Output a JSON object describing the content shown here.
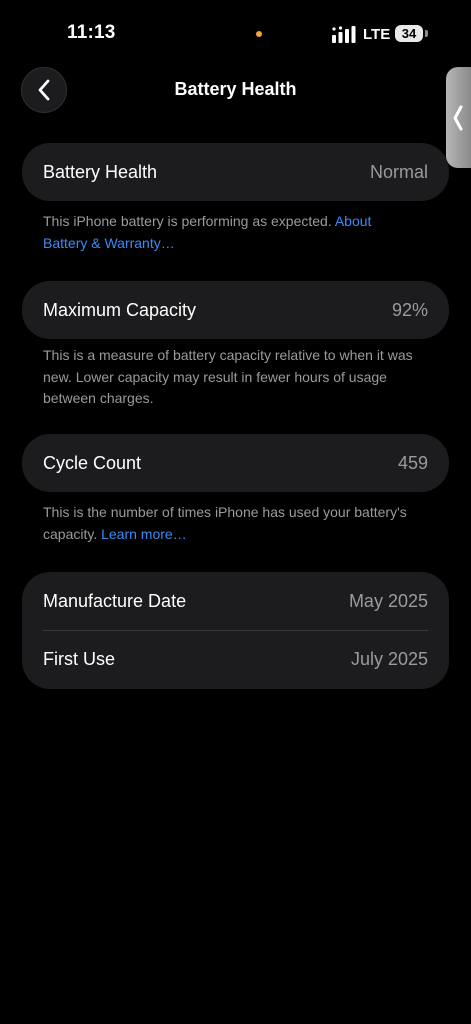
{
  "status_bar": {
    "time": "11:13",
    "network": "LTE",
    "battery_level": "34"
  },
  "nav": {
    "title": "Battery Health"
  },
  "battery_health": {
    "label": "Battery Health",
    "value": "Normal",
    "footnote": "This iPhone battery is performing as expected.",
    "footnote_link": "About Battery & Warranty…"
  },
  "max_capacity": {
    "label": "Maximum Capacity",
    "value": "92%",
    "footnote": "This is a measure of battery capacity relative to when it was new. Lower capacity may result in fewer hours of usage between charges."
  },
  "cycle_count": {
    "label": "Cycle Count",
    "value": "459",
    "footnote": "This is the number of times iPhone has used your battery's capacity.",
    "footnote_link": "Learn more…"
  },
  "dates": {
    "manufacture_label": "Manufacture Date",
    "manufacture_value": "May 2025",
    "first_use_label": "First Use",
    "first_use_value": "July 2025"
  },
  "icons": {
    "back": "chevron-left-icon",
    "side_handle": "chevron-left-icon",
    "signal": "cellular-signal-icon",
    "battery": "battery-icon"
  },
  "colors": {
    "background": "#000000",
    "card": "#1c1c1e",
    "secondary_text": "#9a9aa0",
    "link": "#3b8bf5",
    "privacy_dot": "#f5a63a"
  }
}
